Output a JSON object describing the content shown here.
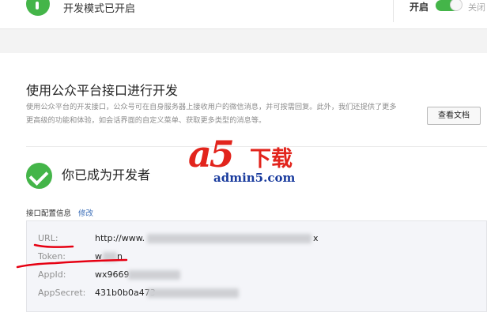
{
  "header": {
    "mode_title": "开发模式已开启",
    "toggle_on_label": "开启",
    "toggle_off_label": "关闭"
  },
  "intro": {
    "title": "使用公众平台接口进行开发",
    "description": "使用公众平台的开发接口，公众号可在自身服务器上接收用户的微信消息，并可按需回复。此外，我们还提供了更多更高级的功能和体验，如会话界面的自定义菜单、获取更多类型的消息等。",
    "doc_button": "查看文档"
  },
  "developer": {
    "title": "你已成为开发者"
  },
  "watermark": {
    "logo": "a5",
    "cn_text": "下载",
    "domain": "admin5.com"
  },
  "config": {
    "label": "接口配置信息",
    "edit_link": "修改",
    "fields": [
      {
        "label": "URL:",
        "value_prefix": "http://www.",
        "value_suffix": "x"
      },
      {
        "label": "Token:",
        "value_prefix": "w",
        "value_suffix": "n"
      },
      {
        "label": "AppId:",
        "value_prefix": "wx9669",
        "value_suffix": ""
      },
      {
        "label": "AppSecret:",
        "value_prefix": "431b0b0a473",
        "value_suffix": ""
      }
    ]
  },
  "colors": {
    "accent_green": "#44b549",
    "link_blue": "#3d6fb8",
    "annotation_red": "#e60012"
  }
}
